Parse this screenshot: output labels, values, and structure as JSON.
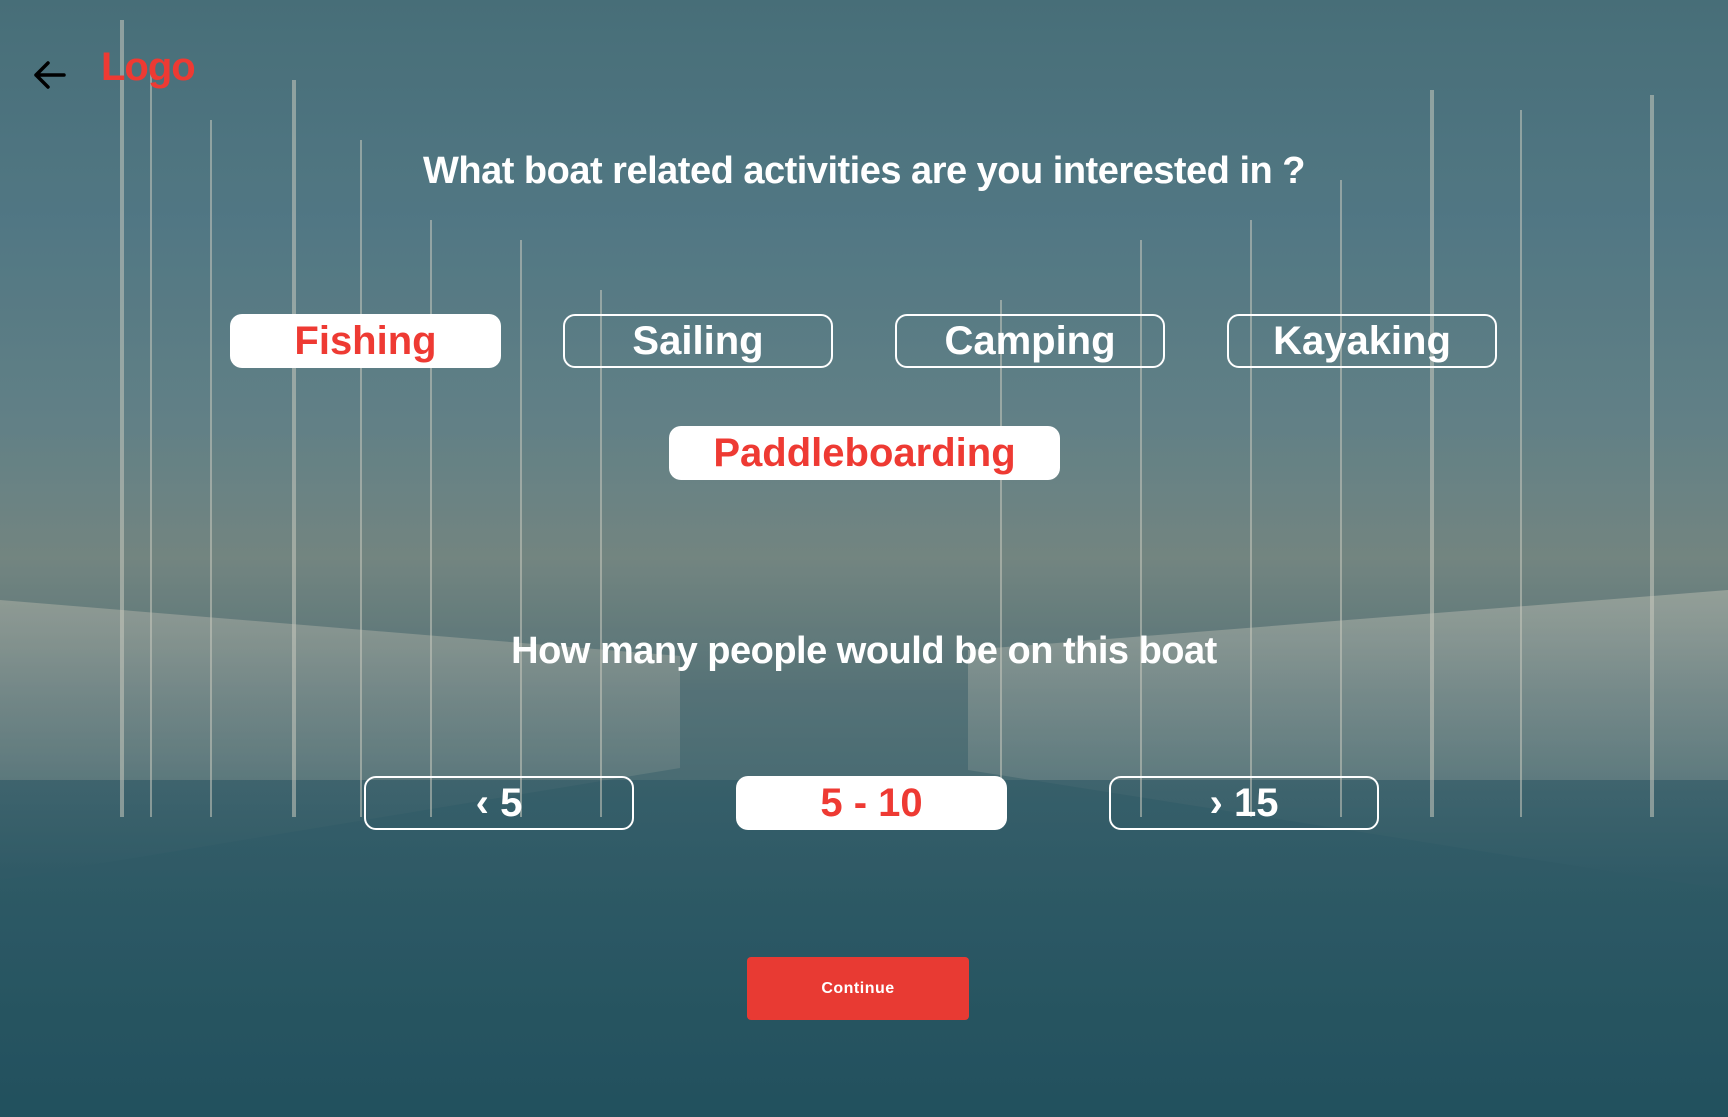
{
  "header": {
    "logo_text": "Logo",
    "back_icon": "arrow-left-icon"
  },
  "activities": {
    "question": "What boat related activities are you interested in ?",
    "options": [
      {
        "label": "Fishing",
        "selected": true
      },
      {
        "label": "Sailing",
        "selected": false
      },
      {
        "label": "Camping",
        "selected": false
      },
      {
        "label": "Kayaking",
        "selected": false
      },
      {
        "label": "Paddleboarding",
        "selected": true
      }
    ]
  },
  "people": {
    "question": "How many people would be on this boat",
    "options": [
      {
        "label": "‹ 5",
        "selected": false
      },
      {
        "label": "5 - 10",
        "selected": true
      },
      {
        "label": "› 15",
        "selected": false
      }
    ]
  },
  "continue_label": "Continue",
  "colors": {
    "accent": "#ee3a33",
    "button": "#e83a33",
    "text": "#ffffff"
  }
}
